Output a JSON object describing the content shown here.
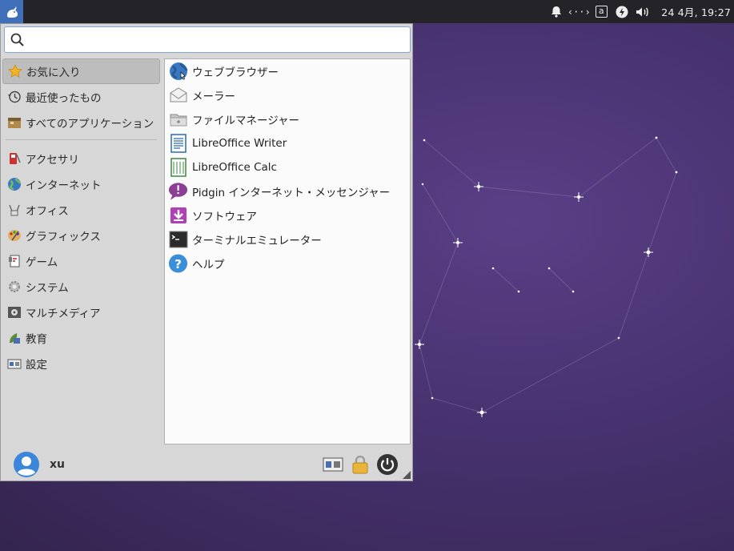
{
  "panel": {
    "clock": "24 4月, 19:27",
    "keyboard_layout": "a"
  },
  "search": {
    "value": "",
    "placeholder": ""
  },
  "categories": [
    {
      "label": "お気に入り",
      "icon": "star-icon",
      "active": true
    },
    {
      "label": "最近使ったもの",
      "icon": "history-icon"
    },
    {
      "label": "すべてのアプリケーション",
      "icon": "all-apps-icon"
    },
    {
      "label": "アクセサリ",
      "icon": "accessories-icon"
    },
    {
      "label": "インターネット",
      "icon": "globe-icon"
    },
    {
      "label": "オフィス",
      "icon": "office-icon"
    },
    {
      "label": "グラフィックス",
      "icon": "palette-icon"
    },
    {
      "label": "ゲーム",
      "icon": "games-icon"
    },
    {
      "label": "システム",
      "icon": "system-gear-icon"
    },
    {
      "label": "マルチメディア",
      "icon": "multimedia-icon"
    },
    {
      "label": "教育",
      "icon": "education-icon"
    },
    {
      "label": "設定",
      "icon": "settings-icon"
    }
  ],
  "apps": [
    {
      "label": "ウェブブラウザー",
      "icon": "web-browser-icon"
    },
    {
      "label": "メーラー",
      "icon": "mail-icon"
    },
    {
      "label": "ファイルマネージャー",
      "icon": "folder-icon"
    },
    {
      "label": "LibreOffice Writer",
      "icon": "writer-icon"
    },
    {
      "label": "LibreOffice Calc",
      "icon": "calc-icon"
    },
    {
      "label": "Pidgin インターネット・メッセンジャー",
      "icon": "pidgin-icon"
    },
    {
      "label": "ソフトウェア",
      "icon": "software-icon"
    },
    {
      "label": "ターミナルエミュレーター",
      "icon": "terminal-icon"
    },
    {
      "label": "ヘルプ",
      "icon": "help-icon"
    }
  ],
  "user": {
    "name": "xu"
  },
  "colors": {
    "accent": "#3e6fb8",
    "panel": "#242428",
    "desktop": "#47326f"
  }
}
